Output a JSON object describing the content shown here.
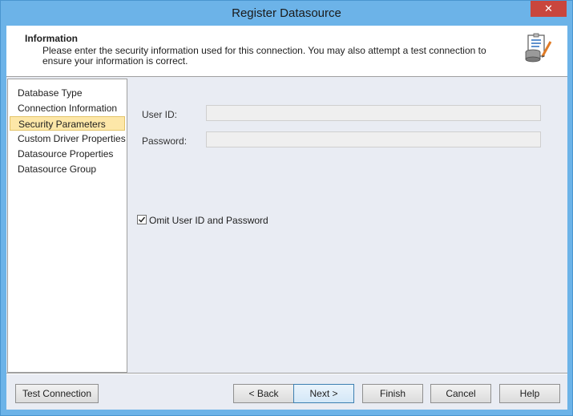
{
  "window": {
    "title": "Register Datasource",
    "close_glyph": "✕"
  },
  "info": {
    "title": "Information",
    "description": "Please enter the security information used for this connection.  You may also attempt a test connection to ensure your information is correct.",
    "icon": "datasource-register-icon"
  },
  "nav": {
    "items": [
      {
        "label": "Database Type",
        "selected": false
      },
      {
        "label": "Connection Information",
        "selected": false
      },
      {
        "label": "Security Parameters",
        "selected": true
      },
      {
        "label": "Custom Driver Properties",
        "selected": false
      },
      {
        "label": "Datasource Properties",
        "selected": false
      },
      {
        "label": "Datasource Group",
        "selected": false
      }
    ]
  },
  "form": {
    "user_id_label": "User ID:",
    "user_id_value": "",
    "password_label": "Password:",
    "password_value": "",
    "omit_label": "Omit User ID and Password",
    "omit_checked": true
  },
  "buttons": {
    "test_connection": "Test Connection",
    "back": "< Back",
    "next": "Next >",
    "finish": "Finish",
    "cancel": "Cancel",
    "help": "Help"
  },
  "colors": {
    "title_bar": "#6cb3e8",
    "close_button": "#c9463d",
    "selection": "#fde7a8",
    "dialog_bg": "#e9ecf3"
  }
}
